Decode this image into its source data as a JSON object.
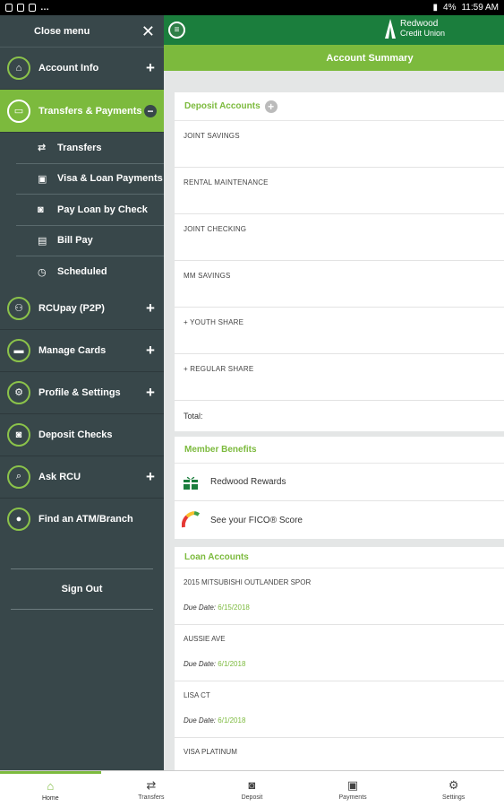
{
  "status_bar": {
    "battery": "4%",
    "time": "11:59 AM"
  },
  "menu": {
    "close_label": "Close menu",
    "items": [
      {
        "label": "Account Info",
        "icon": "home-icon"
      },
      {
        "label": "Transfers & Payments",
        "icon": "money-icon"
      },
      {
        "label": "RCUpay (P2P)",
        "icon": "people-icon"
      },
      {
        "label": "Manage Cards",
        "icon": "card-icon"
      },
      {
        "label": "Profile & Settings",
        "icon": "gear-icon"
      },
      {
        "label": "Deposit Checks",
        "icon": "camera-icon"
      },
      {
        "label": "Ask RCU",
        "icon": "search-icon"
      },
      {
        "label": "Find an ATM/Branch",
        "icon": "location-icon"
      }
    ],
    "sub_items": [
      {
        "label": "Transfers",
        "icon": "transfer-icon"
      },
      {
        "label": "Visa & Loan Payments",
        "icon": "payment-icon"
      },
      {
        "label": "Pay Loan by Check",
        "icon": "camera-icon"
      },
      {
        "label": "Bill Pay",
        "icon": "bill-icon"
      },
      {
        "label": "Scheduled",
        "icon": "clock-icon"
      }
    ],
    "sign_out": "Sign Out"
  },
  "header": {
    "logo_line1": "Redwood",
    "logo_line2": "Credit Union",
    "title": "Account Summary"
  },
  "deposit": {
    "heading": "Deposit Accounts",
    "accounts": [
      "JOINT SAVINGS",
      "RENTAL MAINTENANCE",
      "JOINT CHECKING",
      "MM SAVINGS",
      "+ YOUTH SHARE",
      "+ REGULAR SHARE"
    ],
    "total_label": "Total:"
  },
  "benefits": {
    "heading": "Member Benefits",
    "items": [
      "Redwood Rewards",
      "See your FICO® Score"
    ]
  },
  "loans": {
    "heading": "Loan Accounts",
    "due_label": "Due Date:",
    "items": [
      {
        "name": "2015 MITSUBISHI OUTLANDER SPOR",
        "due": "6/15/2018"
      },
      {
        "name": "AUSSIE AVE",
        "due": "6/1/2018"
      },
      {
        "name": "LISA CT",
        "due": "6/1/2018"
      },
      {
        "name": "VISA PLATINUM",
        "due": ""
      }
    ]
  },
  "bottom_nav": [
    {
      "label": "Home",
      "icon": "home-icon"
    },
    {
      "label": "Transfers",
      "icon": "transfer-icon"
    },
    {
      "label": "Deposit",
      "icon": "camera-icon"
    },
    {
      "label": "Payments",
      "icon": "money-icon"
    },
    {
      "label": "Settings",
      "icon": "gear-icon"
    }
  ],
  "colors": {
    "accent": "#7cba3d",
    "brand": "#1b7e3d",
    "menu_bg": "#38474a"
  }
}
